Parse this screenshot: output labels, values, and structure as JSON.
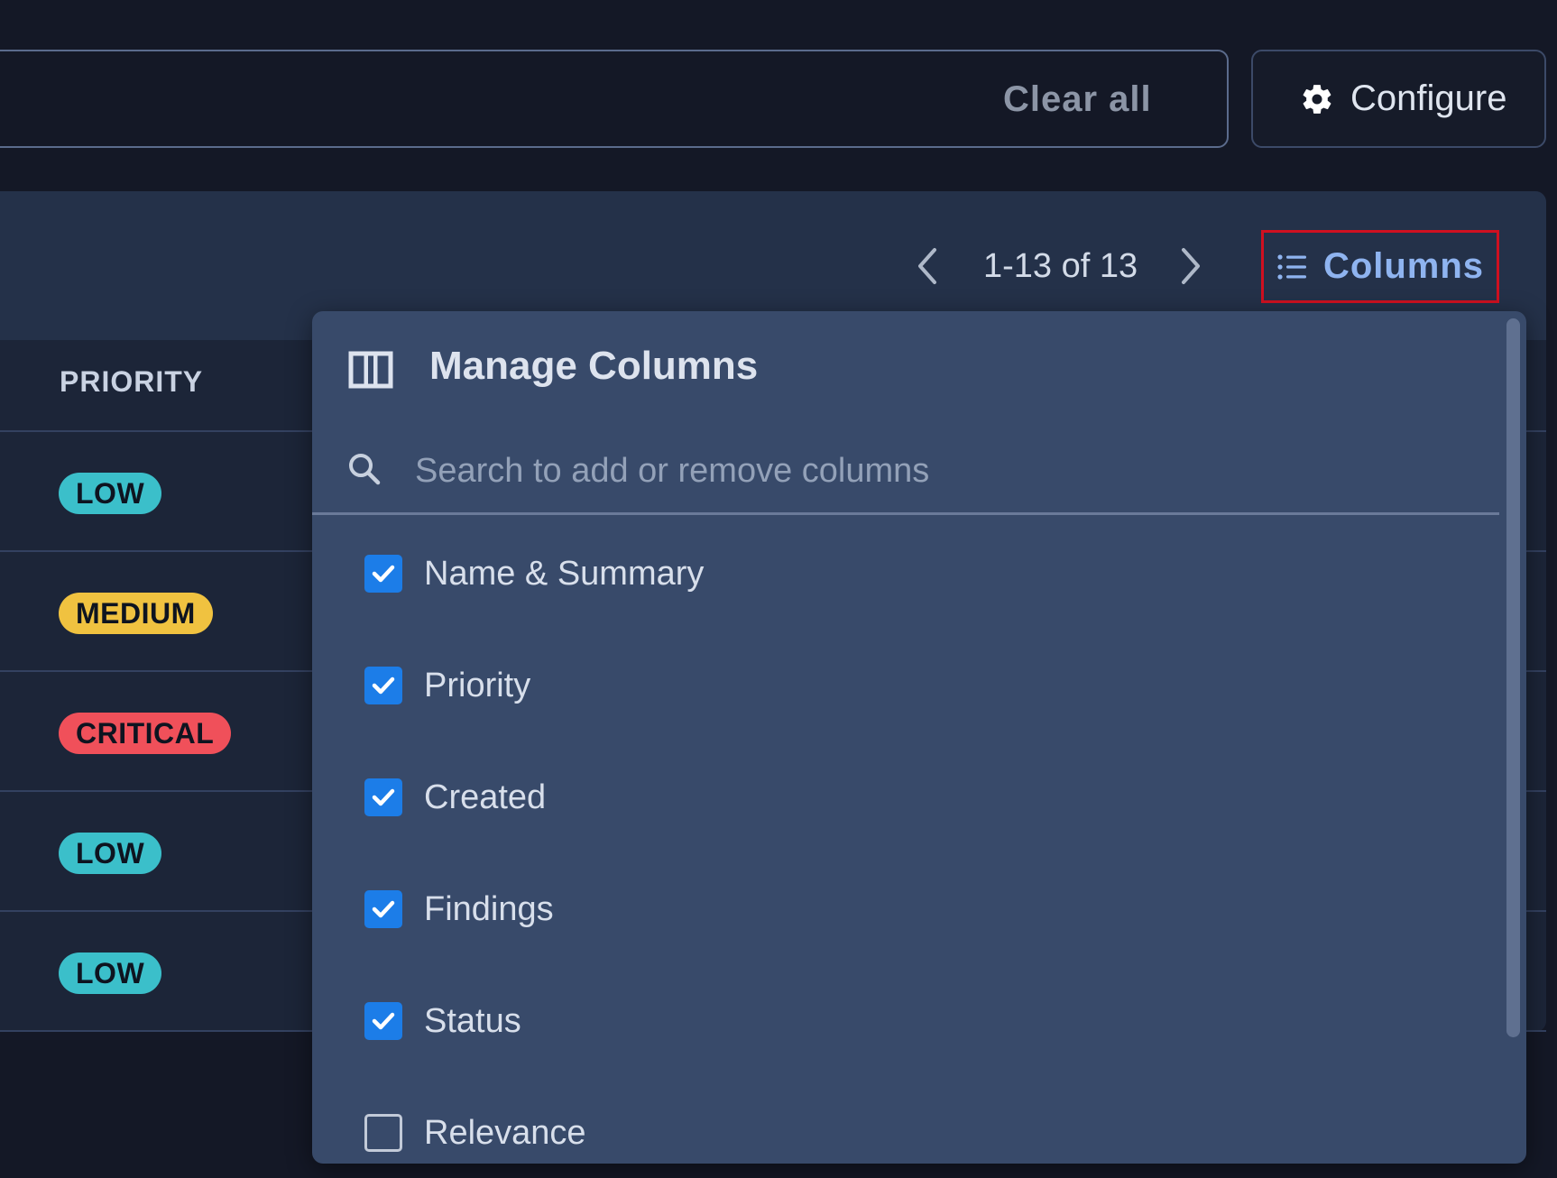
{
  "toolbar": {
    "clear_all_label": "Clear all",
    "configure_label": "Configure"
  },
  "pager": {
    "range_text": "1-13 of 13"
  },
  "columns_button": {
    "label": "Columns"
  },
  "table": {
    "header_priority": "PRIORITY",
    "rows": [
      {
        "priority": "LOW"
      },
      {
        "priority": "MEDIUM"
      },
      {
        "priority": "CRITICAL"
      },
      {
        "priority": "LOW"
      },
      {
        "priority": "LOW"
      }
    ]
  },
  "manage_columns": {
    "title": "Manage Columns",
    "search_placeholder": "Search to add or remove columns",
    "options": [
      {
        "label": "Name & Summary",
        "checked": true
      },
      {
        "label": "Priority",
        "checked": true
      },
      {
        "label": "Created",
        "checked": true
      },
      {
        "label": "Findings",
        "checked": true
      },
      {
        "label": "Status",
        "checked": true
      },
      {
        "label": "Relevance",
        "checked": false
      }
    ]
  },
  "colors": {
    "accent": "#1c7de8",
    "badge_low": "#3bbfca",
    "badge_medium": "#f0c240",
    "badge_critical": "#f0505a",
    "highlight_border": "#d01020"
  },
  "icons": {
    "configure": "gear-icon",
    "columns": "list-icon",
    "title": "table-columns-icon",
    "search": "search-icon",
    "prev": "chevron-left-icon",
    "next": "chevron-right-icon",
    "check": "check-icon"
  }
}
